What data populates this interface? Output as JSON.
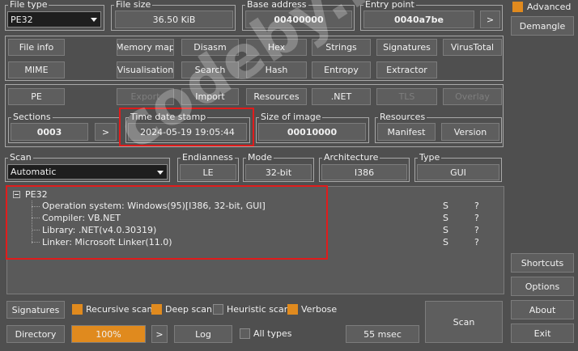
{
  "file_type": {
    "legend": "File type",
    "value": "PE32"
  },
  "file_size": {
    "legend": "File size",
    "value": "36.50 KiB"
  },
  "base_address": {
    "legend": "Base address",
    "value": "00400000"
  },
  "entry_point": {
    "legend": "Entry point",
    "value": "0040a7be",
    "button": ">"
  },
  "side": {
    "advanced_label": "Advanced",
    "advanced_checked": true,
    "demangle": "Demangle",
    "shortcuts": "Shortcuts",
    "options": "Options",
    "about": "About",
    "exit": "Exit"
  },
  "tools_row1": [
    "File info",
    "Memory map",
    "Disasm",
    "Hex",
    "Strings",
    "Signatures",
    "VirusTotal"
  ],
  "tools_row2": [
    "MIME",
    "Visualisation",
    "Search",
    "Hash",
    "Entropy",
    "Extractor"
  ],
  "pe_row": {
    "pe": "PE",
    "export": "Export",
    "import": "Import",
    "resources": "Resources",
    "net": ".NET",
    "tls": "TLS",
    "overlay": "Overlay"
  },
  "sections": {
    "legend": "Sections",
    "value": "0003",
    "button": ">"
  },
  "timestamp": {
    "legend": "Time date stamp",
    "value": "2024-05-19 19:05:44"
  },
  "size_of_image": {
    "legend": "Size of image",
    "value": "00010000"
  },
  "resources_group": {
    "legend": "Resources",
    "manifest": "Manifest",
    "version": "Version"
  },
  "scan": {
    "legend": "Scan",
    "value": "Automatic"
  },
  "endianness": {
    "legend": "Endianness",
    "value": "LE"
  },
  "mode": {
    "legend": "Mode",
    "value": "32-bit"
  },
  "architecture": {
    "legend": "Architecture",
    "value": "I386"
  },
  "type": {
    "legend": "Type",
    "value": "GUI"
  },
  "results": {
    "root": "PE32",
    "items": [
      {
        "text": "Operation system: Windows(95)[I386, 32-bit, GUI]",
        "s": "S",
        "q": "?"
      },
      {
        "text": "Compiler: VB.NET",
        "s": "S",
        "q": "?"
      },
      {
        "text": "Library: .NET(v4.0.30319)",
        "s": "S",
        "q": "?"
      },
      {
        "text": "Linker: Microsoft Linker(11.0)",
        "s": "S",
        "q": "?"
      }
    ]
  },
  "bottom": {
    "signatures": "Signatures",
    "recursive_scan": "Recursive scan",
    "recursive_checked": true,
    "deep_scan": "Deep scan",
    "deep_checked": true,
    "heuristic_scan": "Heuristic scan",
    "heuristic_checked": false,
    "verbose": "Verbose",
    "verbose_checked": true,
    "directory": "Directory",
    "progress": "100%",
    "progress_value": 1.0,
    "next": ">",
    "log": "Log",
    "all_types": "All types",
    "all_types_checked": false,
    "elapsed": "55 msec",
    "scan_button": "Scan"
  },
  "watermark": "codeby.net",
  "colors": {
    "accent": "#e08a1e",
    "highlight_box": "#e01c1c",
    "background": "#4f4f4f"
  }
}
